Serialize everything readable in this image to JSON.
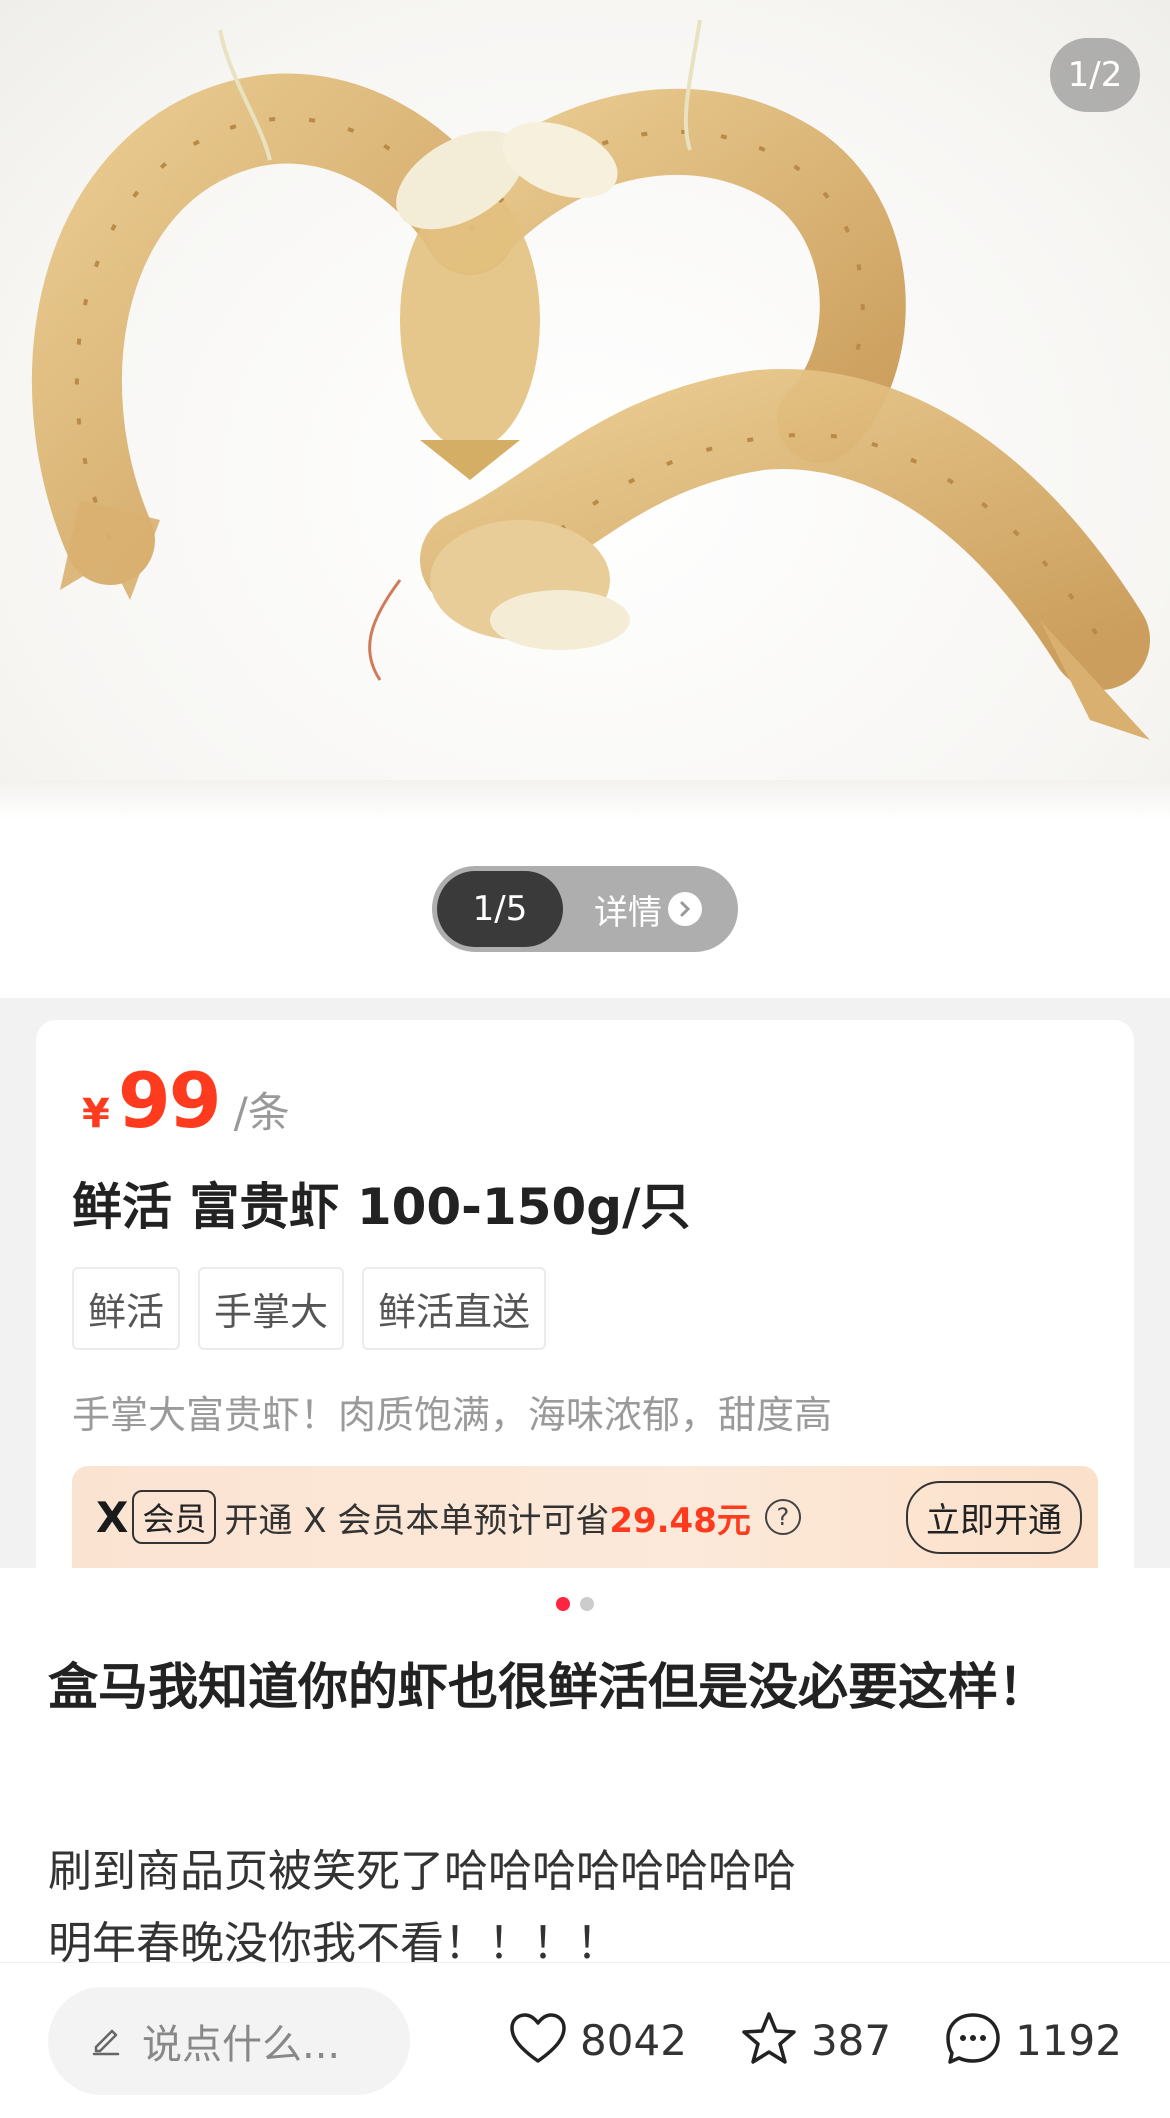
{
  "image_viewer": {
    "counter": "1/2",
    "pager": {
      "current": "1/5",
      "details_label": "详情"
    }
  },
  "product": {
    "price_symbol": "¥",
    "price": "99",
    "unit": "/条",
    "title": "鲜活 富贵虾 100-150g/只",
    "tags": [
      "鲜活",
      "手掌大",
      "鲜活直送"
    ],
    "description": "手掌大富贵虾！肉质饱满，海味浓郁，甜度高",
    "vip": {
      "logo": "X",
      "badge": "会员",
      "text": "开通 X 会员本单预计可省",
      "saving": "29.48元",
      "button": "立即开通"
    }
  },
  "post": {
    "title": "盒马我知道你的虾也很鲜活但是没必要这样！",
    "body_lines": [
      "刷到商品页被笑死了哈哈哈哈哈哈哈哈",
      "明年春晚没你我不看！！！！"
    ]
  },
  "bottom_bar": {
    "comment_placeholder": "说点什么...",
    "likes": "8042",
    "favorites": "387",
    "comments": "1192"
  },
  "colors": {
    "accent_red": "#ff3b1f",
    "brand_red": "#ff2442"
  }
}
